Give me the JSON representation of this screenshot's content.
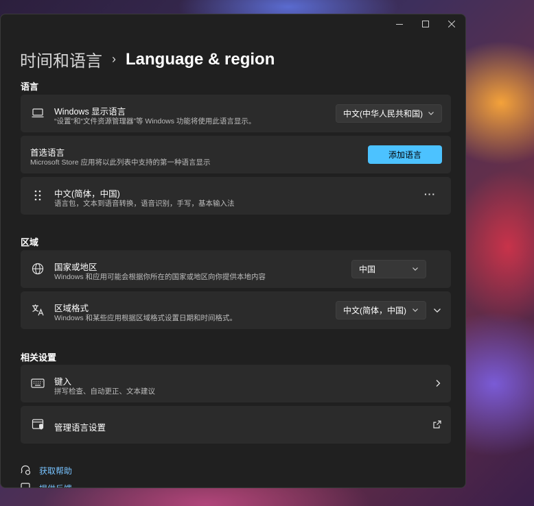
{
  "window": {
    "buttons": {
      "minimize_icon": "minimize-icon",
      "maximize_icon": "maximize-icon",
      "close_icon": "close-icon"
    }
  },
  "breadcrumb": {
    "parent": "时间和语言",
    "separator": "›",
    "current": "Language & region"
  },
  "sections": {
    "language": "语言",
    "region": "区域",
    "related": "相关设置"
  },
  "display_language": {
    "title": "Windows 显示语言",
    "subtitle": "“设置”和“文件资源管理器”等 Windows 功能将使用此语言显示。",
    "selected": "中文(中华人民共和国)"
  },
  "preferred_language": {
    "title": "首选语言",
    "subtitle": "Microsoft Store 应用将以此列表中支持的第一种语言显示",
    "add_button": "添加语言"
  },
  "installed_language": {
    "title": "中文(简体，中国)",
    "subtitle": "语言包，文本到语音转换，语音识别，手写，基本输入法",
    "more": "···"
  },
  "country": {
    "title": "国家或地区",
    "subtitle": "Windows 和应用可能会根据你所在的国家或地区向你提供本地内容",
    "selected": "中国"
  },
  "regional_format": {
    "title": "区域格式",
    "subtitle": "Windows 和某些应用根据区域格式设置日期和时间格式。",
    "selected": "中文(简体，中国)"
  },
  "typing": {
    "title": "键入",
    "subtitle": "拼写检查、自动更正、文本建议"
  },
  "admin_language": {
    "title": "管理语言设置"
  },
  "links": {
    "help": "获取帮助",
    "feedback": "提供反馈"
  },
  "colors": {
    "accent": "#4cc2ff",
    "link": "#78c3ff",
    "card": "#2b2b2b",
    "window": "#202020"
  }
}
